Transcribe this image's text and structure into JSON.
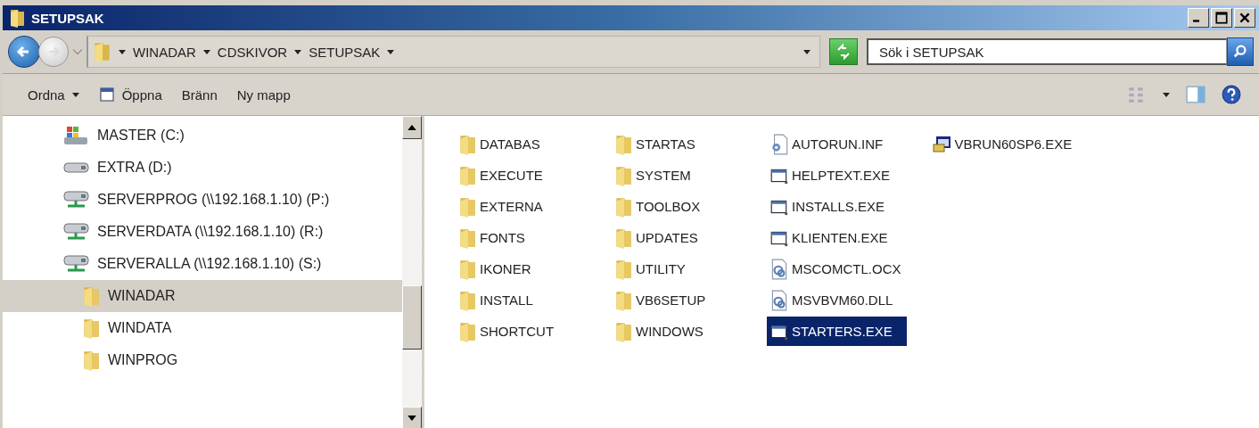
{
  "window": {
    "title": "SETUPSAK"
  },
  "address": {
    "crumbs": [
      "WINADAR",
      "CDSKIVOR",
      "SETUPSAK"
    ]
  },
  "search": {
    "placeholder": "Sök i SETUPSAK"
  },
  "toolbar": [
    {
      "label": "Ordna",
      "kind": "menu"
    },
    {
      "label": "Öppna",
      "kind": "open"
    },
    {
      "label": "Bränn",
      "kind": "plain"
    },
    {
      "label": "Ny mapp",
      "kind": "plain"
    }
  ],
  "tree": [
    {
      "label": "MASTER (C:)",
      "kind": "system-drive",
      "selected": false
    },
    {
      "label": "EXTRA (D:)",
      "kind": "drive",
      "selected": false
    },
    {
      "label": "SERVERPROG (\\\\192.168.1.10) (P:)",
      "kind": "network",
      "selected": false
    },
    {
      "label": "SERVERDATA (\\\\192.168.1.10) (R:)",
      "kind": "network",
      "selected": false
    },
    {
      "label": "SERVERALLA (\\\\192.168.1.10) (S:)",
      "kind": "network",
      "selected": false,
      "children": [
        {
          "label": "WINADAR",
          "kind": "folder",
          "selected": true
        },
        {
          "label": "WINDATA",
          "kind": "folder",
          "selected": false
        },
        {
          "label": "WINPROG",
          "kind": "folder",
          "selected": false
        }
      ]
    }
  ],
  "files": [
    {
      "name": "DATABAS",
      "kind": "folder",
      "selected": false
    },
    {
      "name": "EXECUTE",
      "kind": "folder",
      "selected": false
    },
    {
      "name": "EXTERNA",
      "kind": "folder",
      "selected": false
    },
    {
      "name": "FONTS",
      "kind": "folder",
      "selected": false
    },
    {
      "name": "IKONER",
      "kind": "folder",
      "selected": false
    },
    {
      "name": "INSTALL",
      "kind": "folder",
      "selected": false
    },
    {
      "name": "SHORTCUT",
      "kind": "folder",
      "selected": false
    },
    {
      "name": "STARTAS",
      "kind": "folder",
      "selected": false
    },
    {
      "name": "SYSTEM",
      "kind": "folder",
      "selected": false
    },
    {
      "name": "TOOLBOX",
      "kind": "folder",
      "selected": false
    },
    {
      "name": "UPDATES",
      "kind": "folder",
      "selected": false
    },
    {
      "name": "UTILITY",
      "kind": "folder",
      "selected": false
    },
    {
      "name": "VB6SETUP",
      "kind": "folder",
      "selected": false
    },
    {
      "name": "WINDOWS",
      "kind": "folder",
      "selected": false
    },
    {
      "name": "AUTORUN.INF",
      "kind": "settings",
      "selected": false
    },
    {
      "name": "HELPTEXT.EXE",
      "kind": "program",
      "selected": false
    },
    {
      "name": "INSTALLS.EXE",
      "kind": "program",
      "selected": false
    },
    {
      "name": "KLIENTEN.EXE",
      "kind": "program",
      "selected": false
    },
    {
      "name": "MSCOMCTL.OCX",
      "kind": "library",
      "selected": false
    },
    {
      "name": "MSVBVM60.DLL",
      "kind": "library",
      "selected": false
    },
    {
      "name": "STARTERS.EXE",
      "kind": "program",
      "selected": true
    },
    {
      "name": "VBRUN60SP6.EXE",
      "kind": "installer",
      "selected": false
    }
  ]
}
